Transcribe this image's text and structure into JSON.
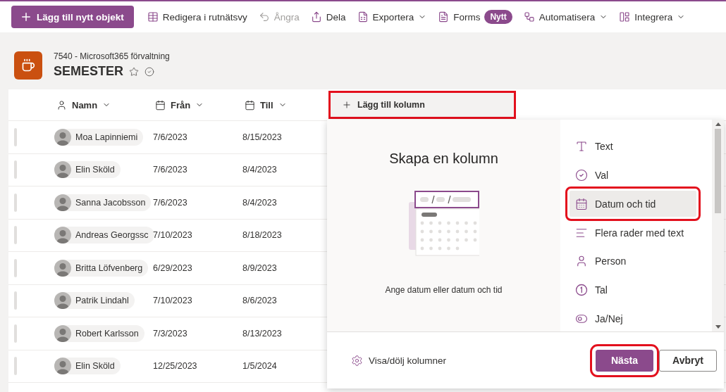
{
  "toolbar": {
    "items": [
      {
        "kind": "primary",
        "label": "Lägg till nytt objekt",
        "disabled": false,
        "has_menu": false
      },
      {
        "kind": "grid",
        "label": "Redigera i rutnätsvy",
        "disabled": false,
        "has_menu": false
      },
      {
        "kind": "undo",
        "label": "Ångra",
        "disabled": true,
        "has_menu": false
      },
      {
        "kind": "share",
        "label": "Dela",
        "disabled": false,
        "has_menu": false
      },
      {
        "kind": "excel",
        "label": "Exportera",
        "disabled": false,
        "has_menu": true
      },
      {
        "kind": "forms",
        "label": "Forms",
        "badge": "Nytt",
        "disabled": false,
        "has_menu": false
      },
      {
        "kind": "flow",
        "label": "Automatisera",
        "disabled": false,
        "has_menu": true
      },
      {
        "kind": "apps",
        "label": "Integrera",
        "disabled": false,
        "has_menu": true
      }
    ]
  },
  "list_header": {
    "site": "7540 - Microsoft365 förvaltning",
    "title": "SEMESTER",
    "favorite": false
  },
  "table": {
    "columns": [
      {
        "kind": "person",
        "label": "Namn"
      },
      {
        "kind": "date",
        "label": "Från"
      },
      {
        "kind": "date",
        "label": "Till"
      }
    ],
    "add_column": {
      "label": "Lägg till kolumn",
      "highlighted": true
    },
    "rows": [
      {
        "name": "Moa Lapinniemi",
        "from": "7/6/2023",
        "to": "8/15/2023"
      },
      {
        "name": "Elin Sköld",
        "from": "7/6/2023",
        "to": "8/4/2023"
      },
      {
        "name": "Sanna Jacobsson",
        "from": "7/6/2023",
        "to": "8/4/2023"
      },
      {
        "name": "Andreas Georgssc",
        "from": "7/10/2023",
        "to": "8/18/2023"
      },
      {
        "name": "Britta Löfvenberg",
        "from": "6/29/2023",
        "to": "8/9/2023"
      },
      {
        "name": "Patrik Lindahl",
        "from": "7/10/2023",
        "to": "8/6/2023"
      },
      {
        "name": "Robert Karlsson",
        "from": "7/3/2023",
        "to": "8/13/2023"
      },
      {
        "name": "Elin Sköld",
        "from": "12/25/2023",
        "to": "1/5/2024"
      }
    ]
  },
  "panel": {
    "title": "Skapa en kolumn",
    "description": "Ange datum eller datum och tid",
    "types": [
      {
        "kind": "text",
        "label": "Text",
        "selected": false,
        "highlighted": false
      },
      {
        "kind": "choice",
        "label": "Val",
        "selected": false,
        "highlighted": false
      },
      {
        "kind": "datetime",
        "label": "Datum och tid",
        "selected": true,
        "highlighted": true
      },
      {
        "kind": "multiline",
        "label": "Flera rader med text",
        "selected": false,
        "highlighted": false
      },
      {
        "kind": "person",
        "label": "Person",
        "selected": false,
        "highlighted": false
      },
      {
        "kind": "number",
        "label": "Tal",
        "selected": false,
        "highlighted": false
      },
      {
        "kind": "yesno",
        "label": "Ja/Nej",
        "selected": false,
        "highlighted": false
      }
    ],
    "footer_link": "Visa/dölj kolumner",
    "buttons": [
      {
        "kind": "primary",
        "label": "Nästa",
        "highlighted": true
      },
      {
        "kind": "secondary",
        "label": "Avbryt",
        "highlighted": false
      }
    ]
  }
}
